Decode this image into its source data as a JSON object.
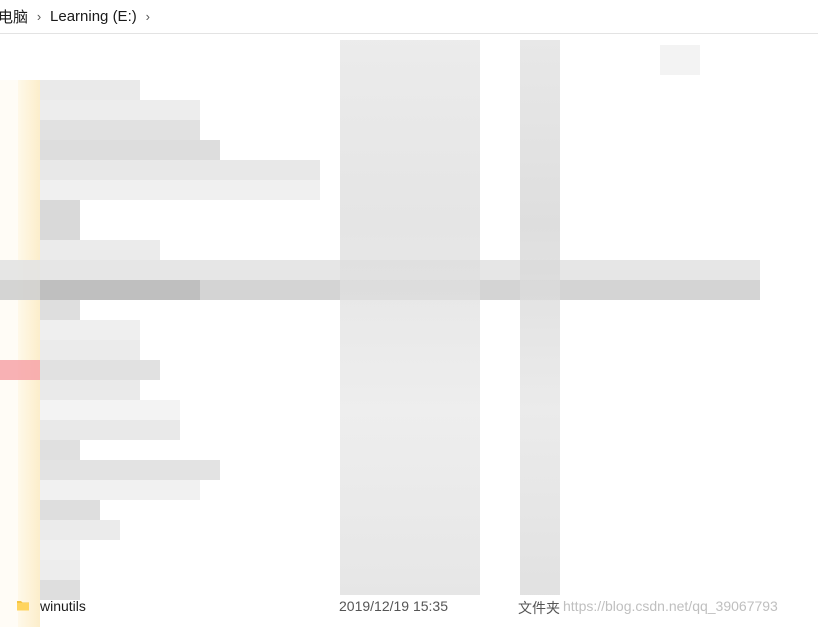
{
  "breadcrumb": {
    "items": [
      {
        "label": "电脑"
      },
      {
        "label": "Learning (E:)"
      }
    ],
    "separator": "›"
  },
  "file_list": {
    "visible_rows": [
      {
        "name": "winutils",
        "modified": "2019/12/19 15:35",
        "type": "文件夹"
      }
    ]
  },
  "watermark": {
    "text": "https://blog.csdn.net/qq_39067793"
  },
  "colors": {
    "folder": "#f5c542",
    "blur_gray": "#d6d6d6",
    "blur_dark": "#b9b9b9",
    "blur_red": "#f7a3a8"
  }
}
